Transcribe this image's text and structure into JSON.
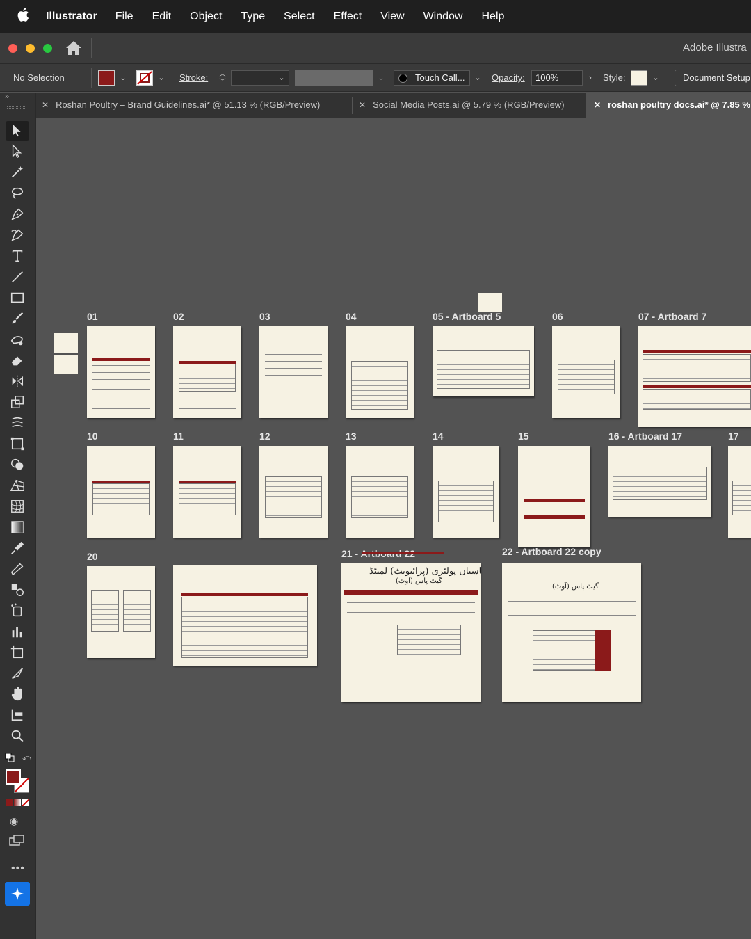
{
  "menubar": {
    "apple_icon": "apple-logo",
    "app_name": "Illustrator",
    "items": [
      "File",
      "Edit",
      "Object",
      "Type",
      "Select",
      "Effect",
      "View",
      "Window",
      "Help"
    ]
  },
  "window": {
    "title": "Adobe Illustra"
  },
  "control_bar": {
    "selection": "No Selection",
    "fill_color": "#8b1a1a",
    "stroke_label": "Stroke:",
    "brush": "Touch Call...",
    "opacity_label": "Opacity:",
    "opacity_value": "100%",
    "style_label": "Style:",
    "document_setup": "Document Setup"
  },
  "tabs": [
    {
      "label": "Roshan Poultry – Brand Guidelines.ai* @ 51.13 % (RGB/Preview)",
      "active": false
    },
    {
      "label": "Social Media Posts.ai @ 5.79 % (RGB/Preview)",
      "active": false
    },
    {
      "label": "roshan poultry docs.ai* @ 7.85 %",
      "active": true
    }
  ],
  "tools": [
    "selection-tool-icon",
    "direct-selection-tool-icon",
    "magic-wand-icon",
    "lasso-icon",
    "pen-icon",
    "curvature-icon",
    "type-icon",
    "line-segment-icon",
    "rectangle-icon",
    "paintbrush-icon",
    "blob-brush-icon",
    "eraser-icon",
    "reflect-icon",
    "scale-icon",
    "warp-icon",
    "free-transform-icon",
    "shape-builder-icon",
    "perspective-grid-icon",
    "mesh-icon",
    "gradient-icon",
    "eyedropper-icon",
    "measure-icon",
    "blend-icon",
    "symbol-sprayer-icon",
    "column-graph-icon",
    "artboard-icon",
    "slice-icon",
    "hand-icon",
    "print-tiling-icon",
    "zoom-icon"
  ],
  "colors": {
    "accent_red": "#8b1a1a",
    "artboard": "#f6f2e3",
    "canvas": "#535353"
  },
  "artboards": {
    "a01": "01",
    "a02": "02",
    "a03": "03",
    "a04": "04",
    "a05": "05 - Artboard 5",
    "a06": "06",
    "a07": "07 - Artboard 7",
    "a10": "10",
    "a11": "11",
    "a12": "12",
    "a13": "13",
    "a14": "14",
    "a15": "15",
    "a16": "16 - Artboard 17",
    "a17": "17",
    "a20": "20",
    "a21": "21 - Artboard 22",
    "a22": "22 - Artboard 22 copy"
  },
  "urdu": {
    "title21": "پاسبان پولٹری (پرائیویٹ) لمیٹڈ",
    "sub21": "گیٹ پاس (آوٹ)",
    "sub22": "گیٹ پاس (آوٹ)"
  }
}
